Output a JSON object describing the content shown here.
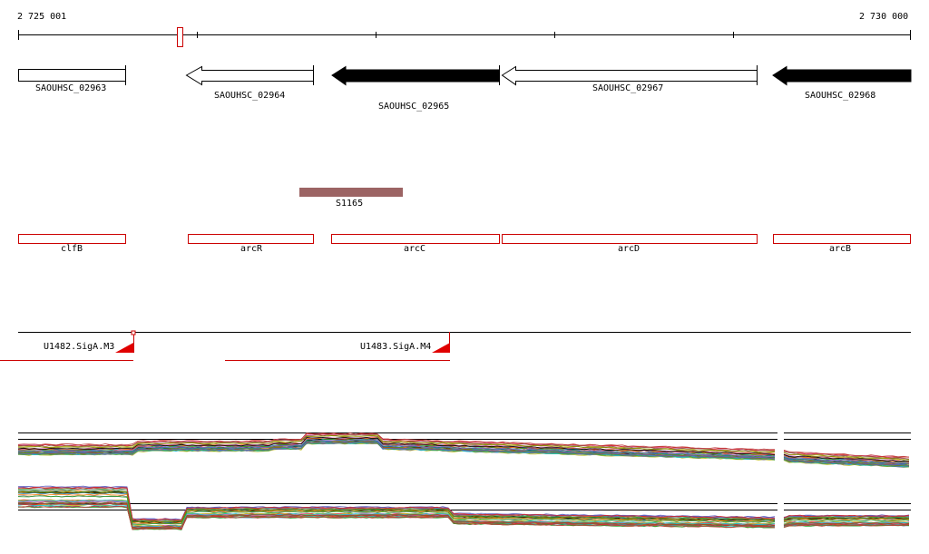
{
  "ruler": {
    "start": "2 725 001",
    "end": "2 730 000"
  },
  "genes": [
    {
      "label": "SAOUHSC_02963"
    },
    {
      "label": "SAOUHSC_02964"
    },
    {
      "label": "SAOUHSC_02965"
    },
    {
      "label": "SAOUHSC_02967"
    },
    {
      "label": "SAOUHSC_02968"
    }
  ],
  "srna": {
    "label": "S1165",
    "color": "#9c6464"
  },
  "names": [
    {
      "label": "clfB"
    },
    {
      "label": "arcR"
    },
    {
      "label": "arcC"
    },
    {
      "label": "arcD"
    },
    {
      "label": "arcB"
    }
  ],
  "promoters": [
    {
      "label": "U1482.SigA.M3"
    },
    {
      "label": "U1483.SigA.M4"
    }
  ],
  "colors": {
    "name_box": "#cc0000",
    "promoter": "#e00000",
    "gene_filled": "#000000"
  }
}
